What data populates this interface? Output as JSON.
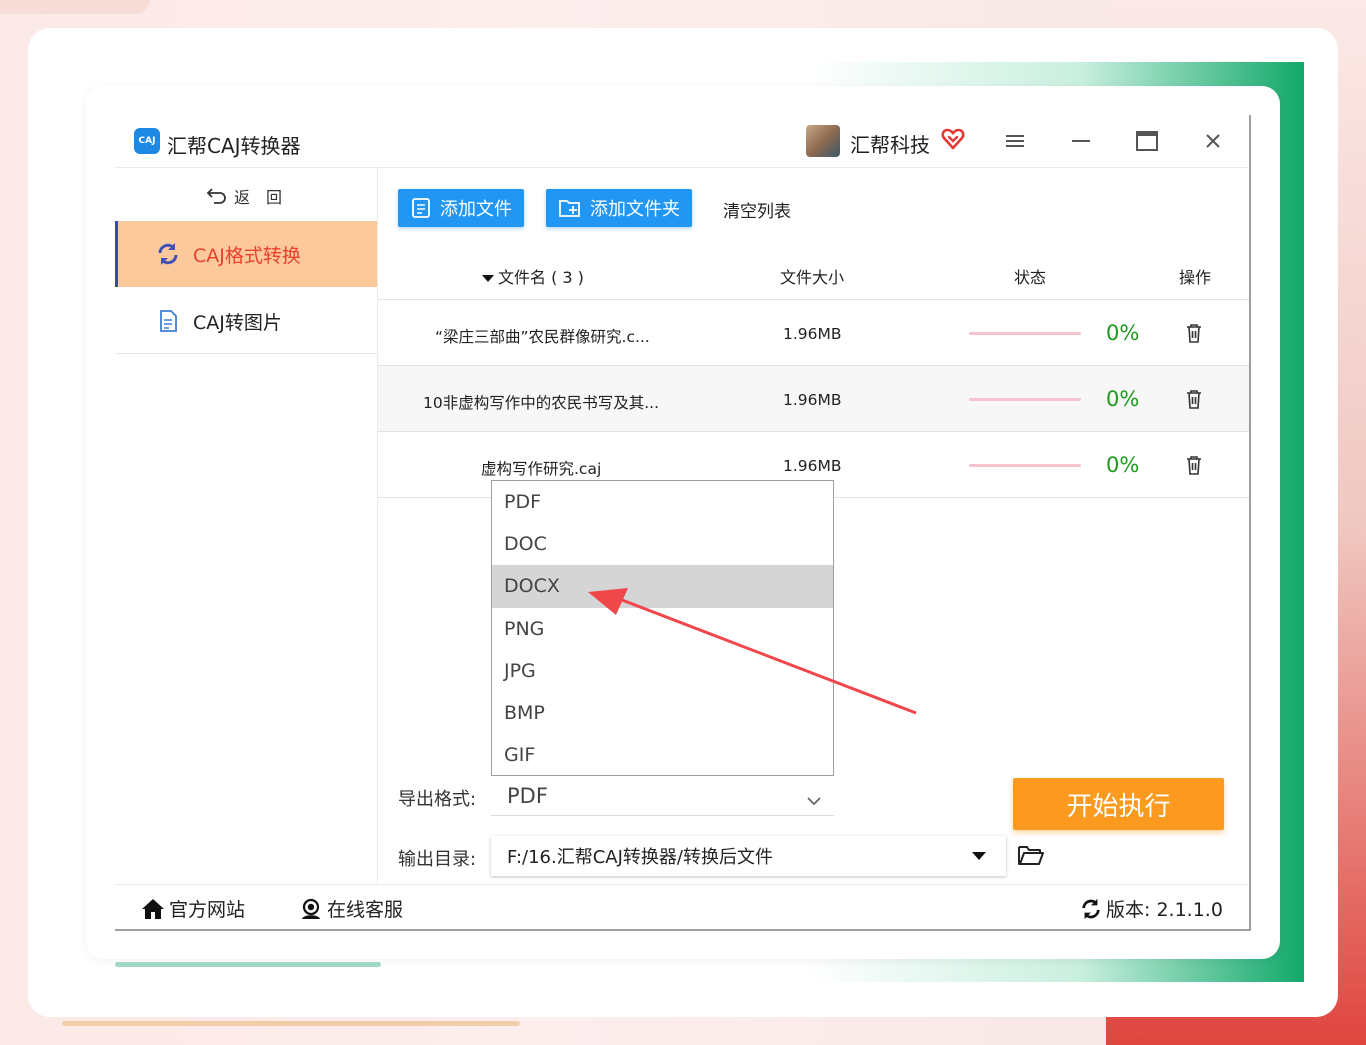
{
  "app": {
    "logo_text": "CAJ",
    "title": "汇帮CAJ转换器"
  },
  "user": {
    "name": "汇帮科技"
  },
  "sidebar": {
    "back_label": "返　回",
    "items": [
      {
        "label": "CAJ格式转换",
        "active": true,
        "icon": "refresh-icon"
      },
      {
        "label": "CAJ转图片",
        "active": false,
        "icon": "document-icon"
      }
    ]
  },
  "toolbar": {
    "add_file": "添加文件",
    "add_folder": "添加文件夹",
    "clear_list": "清空列表"
  },
  "table": {
    "headers": {
      "name": "文件名 ( 3 )",
      "size": "文件大小",
      "status": "状态",
      "action": "操作"
    },
    "rows": [
      {
        "name": "“梁庄三部曲”农民群像研究.c...",
        "size": "1.96MB",
        "progress_pct": 0,
        "percent": "0%"
      },
      {
        "name": "10非虚构写作中的农民书写及其...",
        "size": "1.96MB",
        "progress_pct": 0,
        "percent": "0%"
      },
      {
        "name": "虚构写作研究.caj",
        "size": "1.96MB",
        "progress_pct": 0,
        "percent": "0%"
      }
    ]
  },
  "format_dropdown": {
    "options": [
      "PDF",
      "DOC",
      "DOCX",
      "PNG",
      "JPG",
      "BMP",
      "GIF"
    ],
    "highlighted": "DOCX"
  },
  "settings": {
    "format_label": "导出格式:",
    "format_value": "PDF",
    "output_label": "输出目录:",
    "output_value": "F:/16.汇帮CAJ转换器/转换后文件"
  },
  "start_button": "开始执行",
  "footer": {
    "website": "官方网站",
    "support": "在线客服",
    "version": "版本:  2.1.1.0"
  },
  "colors": {
    "primary_blue": "#2196f3",
    "start_orange": "#fb9a1f",
    "active_bg": "#fcc99c",
    "active_text": "#e8412c",
    "percent_green": "#1e9a1e",
    "annotation_arrow": "#f0474a"
  }
}
